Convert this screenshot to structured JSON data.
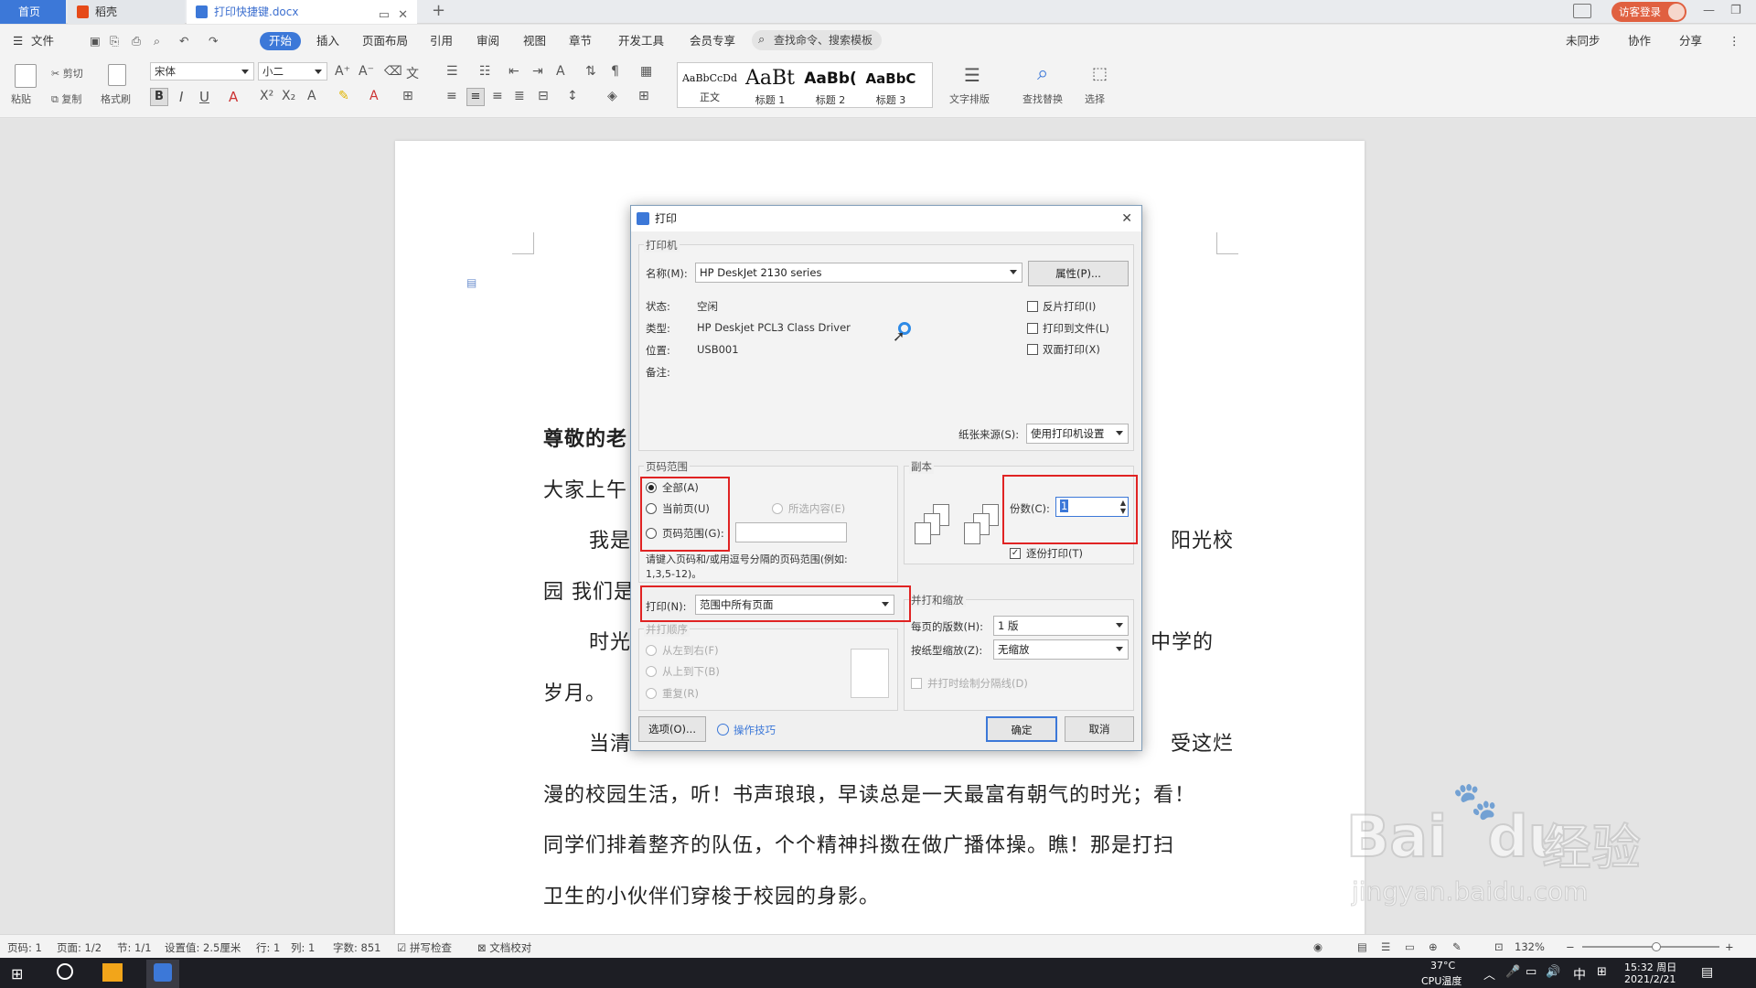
{
  "tabs": {
    "home": "首页",
    "wps": "稻壳",
    "doc": "打印快捷键.docx",
    "new": "+"
  },
  "account": {
    "login": "访客登录"
  },
  "menu": {
    "file": "文件",
    "items": [
      "开始",
      "插入",
      "页面布局",
      "引用",
      "审阅",
      "视图",
      "章节",
      "开发工具",
      "会员专享"
    ],
    "search": "查找命令、搜索模板",
    "sync": "未同步",
    "collab": "协作",
    "share": "分享"
  },
  "ribbon": {
    "paste": "粘贴",
    "cut": "剪切",
    "copy": "复制",
    "format_painter": "格式刷",
    "font": "宋体",
    "size": "小二",
    "styles": [
      {
        "sample": "AaBbCcDd",
        "label": "正文"
      },
      {
        "sample": "AaBt",
        "label": "标题 1"
      },
      {
        "sample": "AaBb(",
        "label": "标题 2"
      },
      {
        "sample": "AaBbC",
        "label": "标题 3"
      }
    ],
    "text_layout": "文字排版",
    "find_replace": "查找替换",
    "select": "选择"
  },
  "document": {
    "line1": "尊敬的老",
    "line2": "大家上午",
    "line3a": "我是",
    "line3b": "阳光校",
    "line4": "园 我们是",
    "line5a": "时光",
    "line5b": "中学的",
    "line6": "岁月。",
    "line7a": "当清",
    "line7b": "受这烂",
    "line8": "漫的校园生活，听！书声琅琅，早读总是一天最富有朝气的时光；看！",
    "line9": "同学们排着整齐的队伍，个个精神抖擞在做广播体操。瞧！那是打扫",
    "line10": "卫生的小伙伴们穿梭于校园的身影。"
  },
  "dialog": {
    "title": "打印",
    "printer_group": "打印机",
    "name_label": "名称(M):",
    "printer_name": "HP DeskJet 2130 series",
    "properties": "属性(P)...",
    "status_label": "状态:",
    "status_value": "空闲",
    "type_label": "类型:",
    "type_value": "HP Deskjet PCL3 Class Driver",
    "location_label": "位置:",
    "location_value": "USB001",
    "comment_label": "备注:",
    "reverse_print": "反片打印(I)",
    "print_to_file": "打印到文件(L)",
    "duplex": "双面打印(X)",
    "paper_source_label": "纸张来源(S):",
    "paper_source_value": "使用打印机设置",
    "range_group": "页码范围",
    "range_all": "全部(A)",
    "range_current": "当前页(U)",
    "range_selection": "所选内容(E)",
    "range_pages": "页码范围(G):",
    "range_hint1": "请键入页码和/或用逗号分隔的页码范围(例如:",
    "range_hint2": "1,3,5-12)。",
    "print_label": "打印(N):",
    "print_value": "范围中所有页面",
    "collate_order_group": "并打顺序",
    "order_lr": "从左到右(F)",
    "order_tb": "从上到下(B)",
    "order_repeat": "重复(R)",
    "copies_group": "副本",
    "copies_label": "份数(C):",
    "copies_value": "1",
    "collate": "逐份打印(T)",
    "scale_group": "并打和缩放",
    "pages_per_sheet_label": "每页的版数(H):",
    "pages_per_sheet_value": "1 版",
    "scale_label": "按纸型缩放(Z):",
    "scale_value": "无缩放",
    "draw_borders": "并打时绘制分隔线(D)",
    "options": "选项(O)...",
    "tips": "操作技巧",
    "ok": "确定",
    "cancel": "取消"
  },
  "statusbar": {
    "page": "页码: 1",
    "pages": "页面: 1/2",
    "section": "节: 1/1",
    "setting": "设置值: 2.5厘米",
    "row": "行: 1",
    "col": "列: 1",
    "words": "字数: 851",
    "spell": "拼写检查",
    "proof": "文档校对",
    "zoom": "132%"
  },
  "taskbar": {
    "temp": "37°C",
    "cpu": "CPU温度",
    "ime": "中",
    "time": "15:32 周日",
    "date": "2021/2/21"
  },
  "watermark": {
    "brand": "Bai",
    "brand2": "du",
    "jingyan": "经验",
    "url": "jingyan.baidu.com"
  },
  "colors": {
    "accent": "#3c78d8",
    "highlight": "#e02323",
    "tab_orange": "#e64a19"
  }
}
